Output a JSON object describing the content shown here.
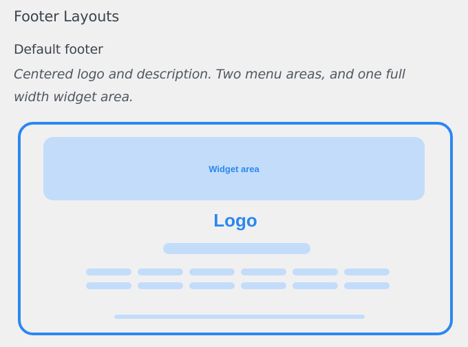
{
  "section": {
    "title": "Footer Layouts"
  },
  "option": {
    "title": "Default footer",
    "description": "Centered logo and description. Two menu areas, and one full width widget area."
  },
  "preview": {
    "widget_label": "Widget area",
    "logo_text": "Logo",
    "selected": true,
    "accent_color": "#2b87f0",
    "placeholder_color": "#c3dcfa"
  }
}
